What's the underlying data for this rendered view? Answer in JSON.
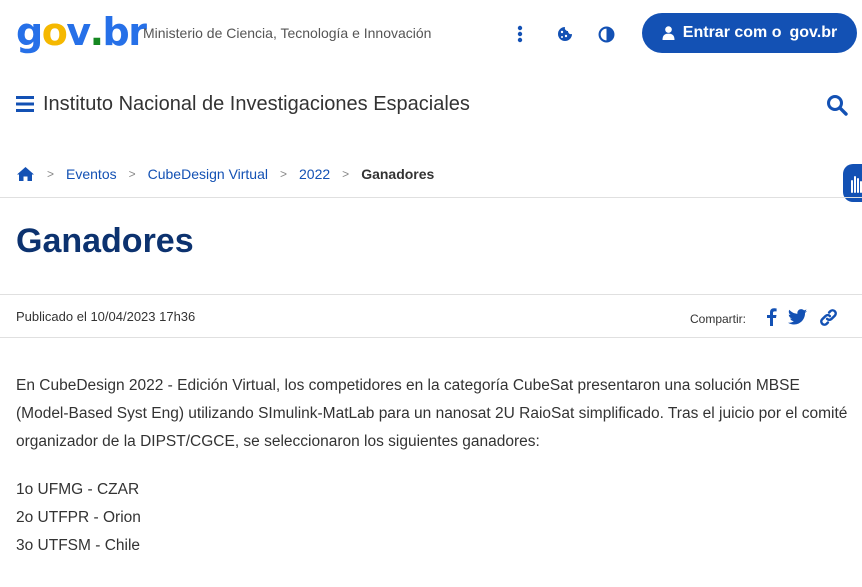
{
  "header": {
    "logo_parts": [
      "g",
      "o",
      "v",
      ".",
      "br"
    ],
    "ministry": "Ministerio de Ciencia, Tecnología e Innovación",
    "login_label_prefix": "Entrar com o",
    "login_label_brand": "gov.br",
    "icons": [
      "more-vertical-icon",
      "cookie-icon",
      "contrast-icon",
      "user-icon"
    ]
  },
  "nav": {
    "site_title": "Instituto Nacional de Investigaciones Espaciales"
  },
  "breadcrumb": {
    "items": [
      {
        "label": "Eventos"
      },
      {
        "label": "CubeDesign Virtual"
      },
      {
        "label": "2022"
      }
    ],
    "current": "Ganadores",
    "separator": ">"
  },
  "article": {
    "title": "Ganadores",
    "published": "Publicado el 10/04/2023 17h36",
    "share_label": "Compartir:",
    "share_icons": [
      "facebook-icon",
      "twitter-icon",
      "link-icon"
    ],
    "paragraph": "En CubeDesign 2022 - Edición Virtual, los competidores en la categoría CubeSat presentaron una solución MBSE (Model-Based Syst Eng) utilizando SImulink-MatLab para un nanosat 2U RaioSat simplificado. Tras el juicio por el comité organizador de la DIPST/CGCE, se seleccionaron los siguientes ganadores:",
    "winners": [
      "1o UFMG - CZAR",
      "2o UTFPR - Orion",
      "3o UTFSM - Chile"
    ]
  },
  "colors": {
    "primary": "#1351b4",
    "title": "#0c326f",
    "logo_blue": "#2670e8",
    "logo_yellow": "#f5b800",
    "logo_green": "#168821"
  }
}
